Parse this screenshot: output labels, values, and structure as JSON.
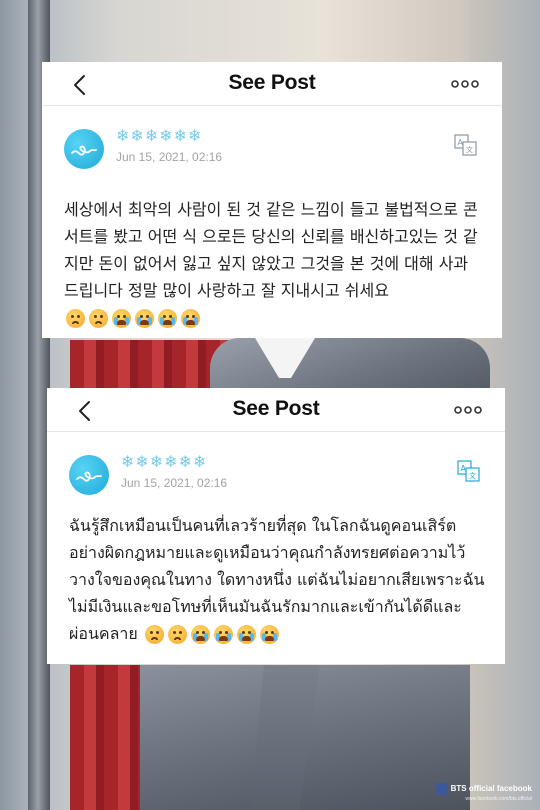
{
  "posts": [
    {
      "header": {
        "title": "See Post"
      },
      "author": {
        "name": "❄❄❄❄❄❄",
        "timestamp": "Jun 15, 2021, 02:16"
      },
      "body": "세상에서 최악의 사람이 된 것 같은 느낌이 들고 불법적으로 콘서트를 봤고 어떤 식 으로든 당신의 신뢰를 배신하고있는 것 같지만 돈이 없어서 잃고 싶지 않았고 그것을 본 것에 대해 사과드립니다 정말 많이 사랑하고 잘 지내시고 쉬세요",
      "emojis": [
        "worried-face-icon",
        "worried-face-icon",
        "crying-face-icon",
        "crying-face-icon",
        "crying-face-icon",
        "crying-face-icon"
      ]
    },
    {
      "header": {
        "title": "See Post"
      },
      "author": {
        "name": "❄❄❄❄❄❄",
        "timestamp": "Jun 15, 2021, 02:16"
      },
      "body": "ฉันรู้สึกเหมือนเป็นคนที่เลวร้ายที่สุด ในโลกฉันดูคอนเสิร์ตอย่างผิดกฎหมายและดูเหมือนว่าคุณกำลังทรยศต่อความไว้วางใจของคุณในทาง ใดทางหนึ่ง แต่ฉันไม่อยากเสียเพราะฉันไม่มีเงินและขอโทษที่เห็นมันฉันรักมากและเข้ากันได้ดีและผ่อนคลาย",
      "emojis": [
        "worried-face-icon",
        "worried-face-icon",
        "crying-face-icon",
        "crying-face-icon",
        "crying-face-icon",
        "crying-face-icon"
      ]
    }
  ],
  "watermark": {
    "label": "BTS official facebook",
    "url": "www.facebook.com/bts.official"
  },
  "colors": {
    "accent": "#1fa8d9",
    "username": "#79cbe6",
    "timestamp": "#a3a3a3"
  }
}
